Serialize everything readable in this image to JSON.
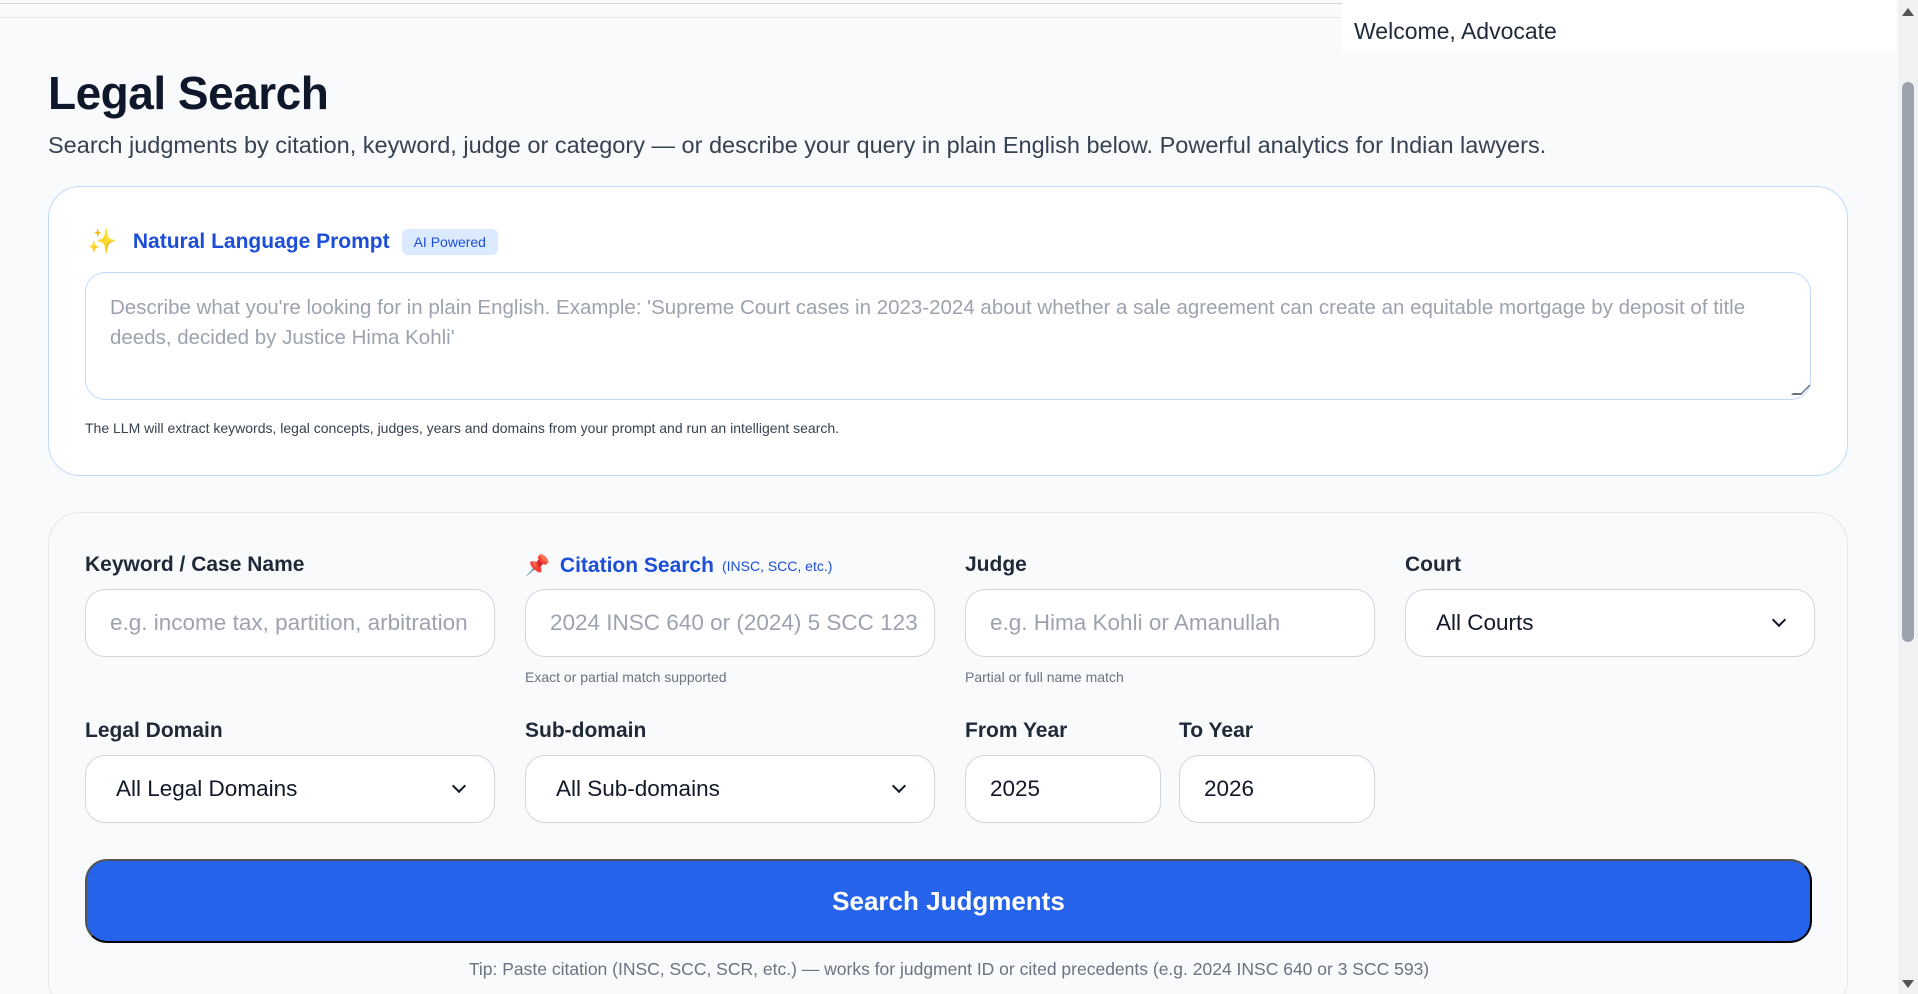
{
  "header": {
    "welcome": "Welcome, Advocate"
  },
  "page": {
    "title": "Legal Search",
    "subtitle": "Search judgments by citation, keyword, judge or category — or describe your query in plain English below. Powerful analytics for Indian lawyers."
  },
  "nl_prompt": {
    "icon": "sparkle-icon",
    "title": "Natural Language Prompt",
    "badge": "AI Powered",
    "placeholder": "Describe what you're looking for in plain English. Example: 'Supreme Court cases in 2023-2024 about whether a sale agreement can create an equitable mortgage by deposit of title deeds, decided by Justice Hima Kohli'",
    "help": "The LLM will extract keywords, legal concepts, judges, years and domains from your prompt and run an intelligent search."
  },
  "form": {
    "keyword": {
      "label": "Keyword / Case Name",
      "placeholder": "e.g. income tax, partition, arbitration"
    },
    "citation": {
      "icon": "pin-icon",
      "label": "Citation Search",
      "hint": "(INSC, SCC, etc.)",
      "placeholder": "2024 INSC 640 or  (2024) 5 SCC 123",
      "help": "Exact or partial match supported"
    },
    "judge": {
      "label": "Judge",
      "placeholder": "e.g. Hima Kohli or Amanullah",
      "help": "Partial or full name match"
    },
    "court": {
      "label": "Court",
      "value": "All Courts"
    },
    "domain": {
      "label": "Legal Domain",
      "value": "All Legal Domains"
    },
    "subdomain": {
      "label": "Sub-domain",
      "value": "All Sub-domains"
    },
    "from_year": {
      "label": "From Year",
      "value": "2025"
    },
    "to_year": {
      "label": "To Year",
      "value": "2026"
    },
    "search_button": "Search Judgments",
    "tip": "Tip: Paste citation (INSC, SCC, SCR, etc.) — works for judgment ID or cited precedents (e.g. 2024 INSC 640 or 3 SCC 593)"
  },
  "colors": {
    "accent": "#2563eb",
    "brand_text": "#1d4ed8",
    "badge_bg": "#dbeafe",
    "pin": "#e11d48",
    "sparkle": "#f59e0b"
  }
}
